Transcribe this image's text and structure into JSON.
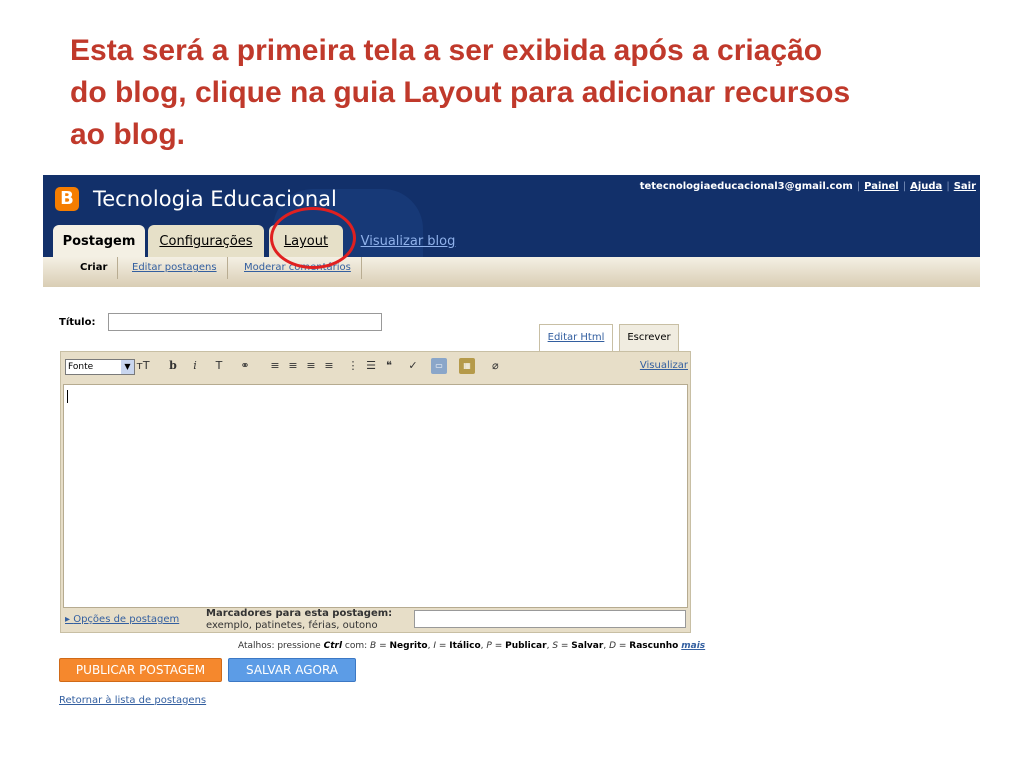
{
  "caption": {
    "line1": "Esta será a primeira tela a ser exibida após a criação",
    "line2": "do blog, clique na guia Layout para adicionar recursos",
    "line3": "ao blog."
  },
  "header": {
    "logo_letter": "B",
    "blog_title": "Tecnologia Educacional",
    "account_email": "tetecnologiaeducacional3@gmail.com",
    "links": [
      "Painel",
      "Ajuda",
      "Sair"
    ]
  },
  "tabs": [
    {
      "label": "Postagem"
    },
    {
      "label": "Configurações"
    },
    {
      "label": "Layout"
    },
    {
      "label": "Visualizar blog"
    }
  ],
  "subnav": [
    "Criar",
    "Editar postagens",
    "Moderar comentários"
  ],
  "form": {
    "title_label": "Título:",
    "title_value": "",
    "mode_tabs": [
      "Editar Html",
      "Escrever"
    ],
    "font_select": "Fonte",
    "toolbar_icons": [
      "font-size-icon",
      "bold-icon",
      "italic-icon",
      "text-color-icon",
      "link-icon",
      "align-left-icon",
      "align-center-icon",
      "align-right-icon",
      "justify-icon",
      "numbered-list-icon",
      "bullet-list-icon",
      "quote-icon",
      "spellcheck-icon",
      "image-icon",
      "video-icon",
      "remove-format-icon"
    ],
    "preview_link": "Visualizar",
    "post_options_link": "Opções de postagem",
    "labels_heading": "Marcadores para esta postagem:",
    "labels_hint": "exemplo, patinetes, férias, outono",
    "labels_value": ""
  },
  "shortcuts": {
    "prefix": "Atalhos: pressione",
    "key": "Ctrl",
    "with": "com:",
    "items": [
      {
        "k": "B",
        "v": "Negrito"
      },
      {
        "k": "I",
        "v": "Itálico"
      },
      {
        "k": "P",
        "v": "Publicar"
      },
      {
        "k": "S",
        "v": "Salvar"
      },
      {
        "k": "D",
        "v": "Rascunho"
      }
    ],
    "more": "mais"
  },
  "buttons": {
    "publish": "PUBLICAR POSTAGEM",
    "save": "SALVAR AGORA"
  },
  "return_link": "Retornar à lista de postagens",
  "colors": {
    "caption": "#c0392b",
    "header_bg": "#12306a",
    "publish_btn": "#f5882d",
    "save_btn": "#5c9ce6",
    "highlight_circle": "#e02020"
  }
}
